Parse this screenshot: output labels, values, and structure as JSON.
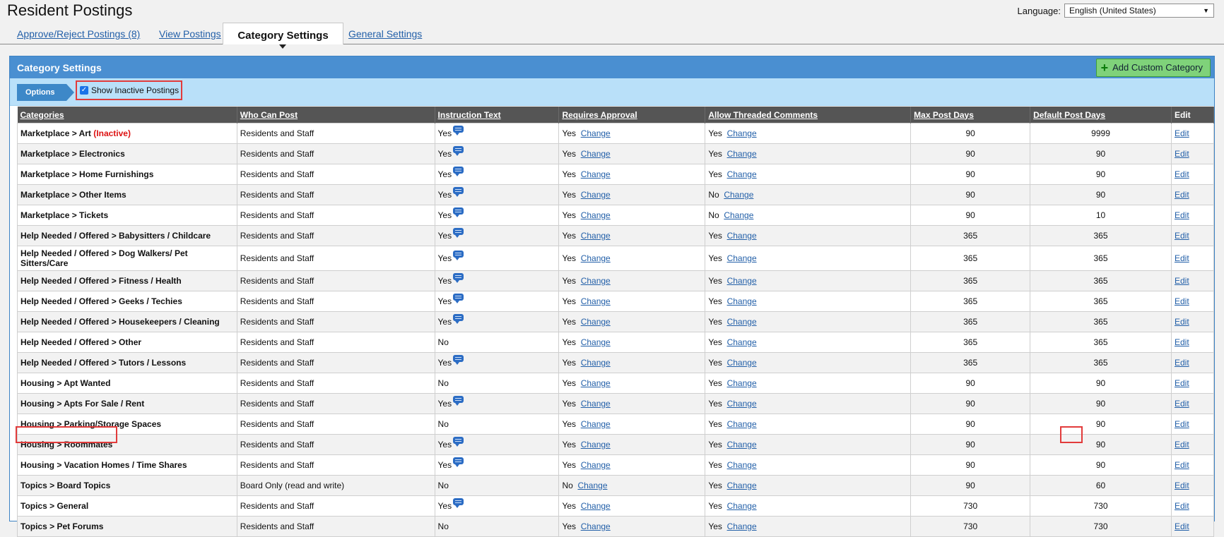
{
  "page": {
    "title": "Resident Postings"
  },
  "language": {
    "label": "Language:",
    "selected": "English (United States)"
  },
  "tabs": [
    {
      "label": "Approve/Reject Postings (8)"
    },
    {
      "label": "View Postings"
    },
    {
      "label": "Category Settings"
    },
    {
      "label": "General Settings"
    }
  ],
  "panel": {
    "title": "Category Settings",
    "add_label": "Add Custom Category",
    "options_label": "Options",
    "show_inactive_label": "Show Inactive Postings"
  },
  "table": {
    "headers": [
      "Categories",
      "Who Can Post",
      "Instruction Text",
      "Requires Approval",
      "Allow Threaded Comments",
      "Max Post Days",
      "Default Post Days",
      "Edit"
    ],
    "change_label": "Change",
    "edit_label": "Edit",
    "inactive_label": "(Inactive)",
    "rows": [
      {
        "category": "Marketplace > Art",
        "inactive": true,
        "who": "Residents and Staff",
        "instr": "Yes",
        "icon": true,
        "approval": "Yes",
        "threaded": "Yes",
        "max": "90",
        "def": "9999"
      },
      {
        "category": "Marketplace > Electronics",
        "who": "Residents and Staff",
        "instr": "Yes",
        "icon": true,
        "approval": "Yes",
        "threaded": "Yes",
        "max": "90",
        "def": "90"
      },
      {
        "category": "Marketplace > Home Furnishings",
        "who": "Residents and Staff",
        "instr": "Yes",
        "icon": true,
        "approval": "Yes",
        "threaded": "Yes",
        "max": "90",
        "def": "90"
      },
      {
        "category": "Marketplace > Other Items",
        "who": "Residents and Staff",
        "instr": "Yes",
        "icon": true,
        "approval": "Yes",
        "threaded": "No",
        "max": "90",
        "def": "90"
      },
      {
        "category": "Marketplace > Tickets",
        "who": "Residents and Staff",
        "instr": "Yes",
        "icon": true,
        "approval": "Yes",
        "threaded": "No",
        "max": "90",
        "def": "10"
      },
      {
        "category": "Help Needed / Offered > Babysitters / Childcare",
        "who": "Residents and Staff",
        "instr": "Yes",
        "icon": true,
        "approval": "Yes",
        "threaded": "Yes",
        "max": "365",
        "def": "365"
      },
      {
        "category": "Help Needed / Offered > Dog Walkers/ Pet Sitters/Care",
        "who": "Residents and Staff",
        "instr": "Yes",
        "icon": true,
        "approval": "Yes",
        "threaded": "Yes",
        "max": "365",
        "def": "365",
        "tall": true
      },
      {
        "category": "Help Needed / Offered > Fitness / Health",
        "who": "Residents and Staff",
        "instr": "Yes",
        "icon": true,
        "approval": "Yes",
        "threaded": "Yes",
        "max": "365",
        "def": "365"
      },
      {
        "category": "Help Needed / Offered > Geeks / Techies",
        "who": "Residents and Staff",
        "instr": "Yes",
        "icon": true,
        "approval": "Yes",
        "threaded": "Yes",
        "max": "365",
        "def": "365"
      },
      {
        "category": "Help Needed / Offered > Housekeepers / Cleaning",
        "who": "Residents and Staff",
        "instr": "Yes",
        "icon": true,
        "approval": "Yes",
        "threaded": "Yes",
        "max": "365",
        "def": "365"
      },
      {
        "category": "Help Needed / Offered > Other",
        "who": "Residents and Staff",
        "instr": "No",
        "icon": false,
        "approval": "Yes",
        "threaded": "Yes",
        "max": "365",
        "def": "365"
      },
      {
        "category": "Help Needed / Offered > Tutors / Lessons",
        "who": "Residents and Staff",
        "instr": "Yes",
        "icon": true,
        "approval": "Yes",
        "threaded": "Yes",
        "max": "365",
        "def": "365"
      },
      {
        "category": "Housing > Apt Wanted",
        "who": "Residents and Staff",
        "instr": "No",
        "icon": false,
        "approval": "Yes",
        "threaded": "Yes",
        "max": "90",
        "def": "90"
      },
      {
        "category": "Housing > Apts For Sale / Rent",
        "who": "Residents and Staff",
        "instr": "Yes",
        "icon": true,
        "approval": "Yes",
        "threaded": "Yes",
        "max": "90",
        "def": "90"
      },
      {
        "category": "Housing > Parking/Storage Spaces",
        "who": "Residents and Staff",
        "instr": "No",
        "icon": false,
        "approval": "Yes",
        "threaded": "Yes",
        "max": "90",
        "def": "90"
      },
      {
        "category": "Housing > Roommates",
        "who": "Residents and Staff",
        "instr": "Yes",
        "icon": true,
        "approval": "Yes",
        "threaded": "Yes",
        "max": "90",
        "def": "90"
      },
      {
        "category": "Housing > Vacation Homes / Time Shares",
        "who": "Residents and Staff",
        "instr": "Yes",
        "icon": true,
        "approval": "Yes",
        "threaded": "Yes",
        "max": "90",
        "def": "90"
      },
      {
        "category": "Topics > Board Topics",
        "who": "Board Only (read and write)",
        "instr": "No",
        "icon": false,
        "approval": "No",
        "threaded": "Yes",
        "max": "90",
        "def": "60"
      },
      {
        "category": "Topics > General",
        "who": "Residents and Staff",
        "instr": "Yes",
        "icon": true,
        "approval": "Yes",
        "threaded": "Yes",
        "max": "730",
        "def": "730"
      },
      {
        "category": "Topics > Pet Forums",
        "who": "Residents and Staff",
        "instr": "No",
        "icon": false,
        "approval": "Yes",
        "threaded": "Yes",
        "max": "730",
        "def": "730"
      }
    ]
  },
  "icons": {
    "instruction": "speech-bubble-icon",
    "add": "plus-icon",
    "dropdown": "caret-down-icon"
  },
  "colors": {
    "header_blue": "#4a8fd1",
    "highlight_red": "#e23b3b",
    "link_blue": "#225fa8"
  }
}
